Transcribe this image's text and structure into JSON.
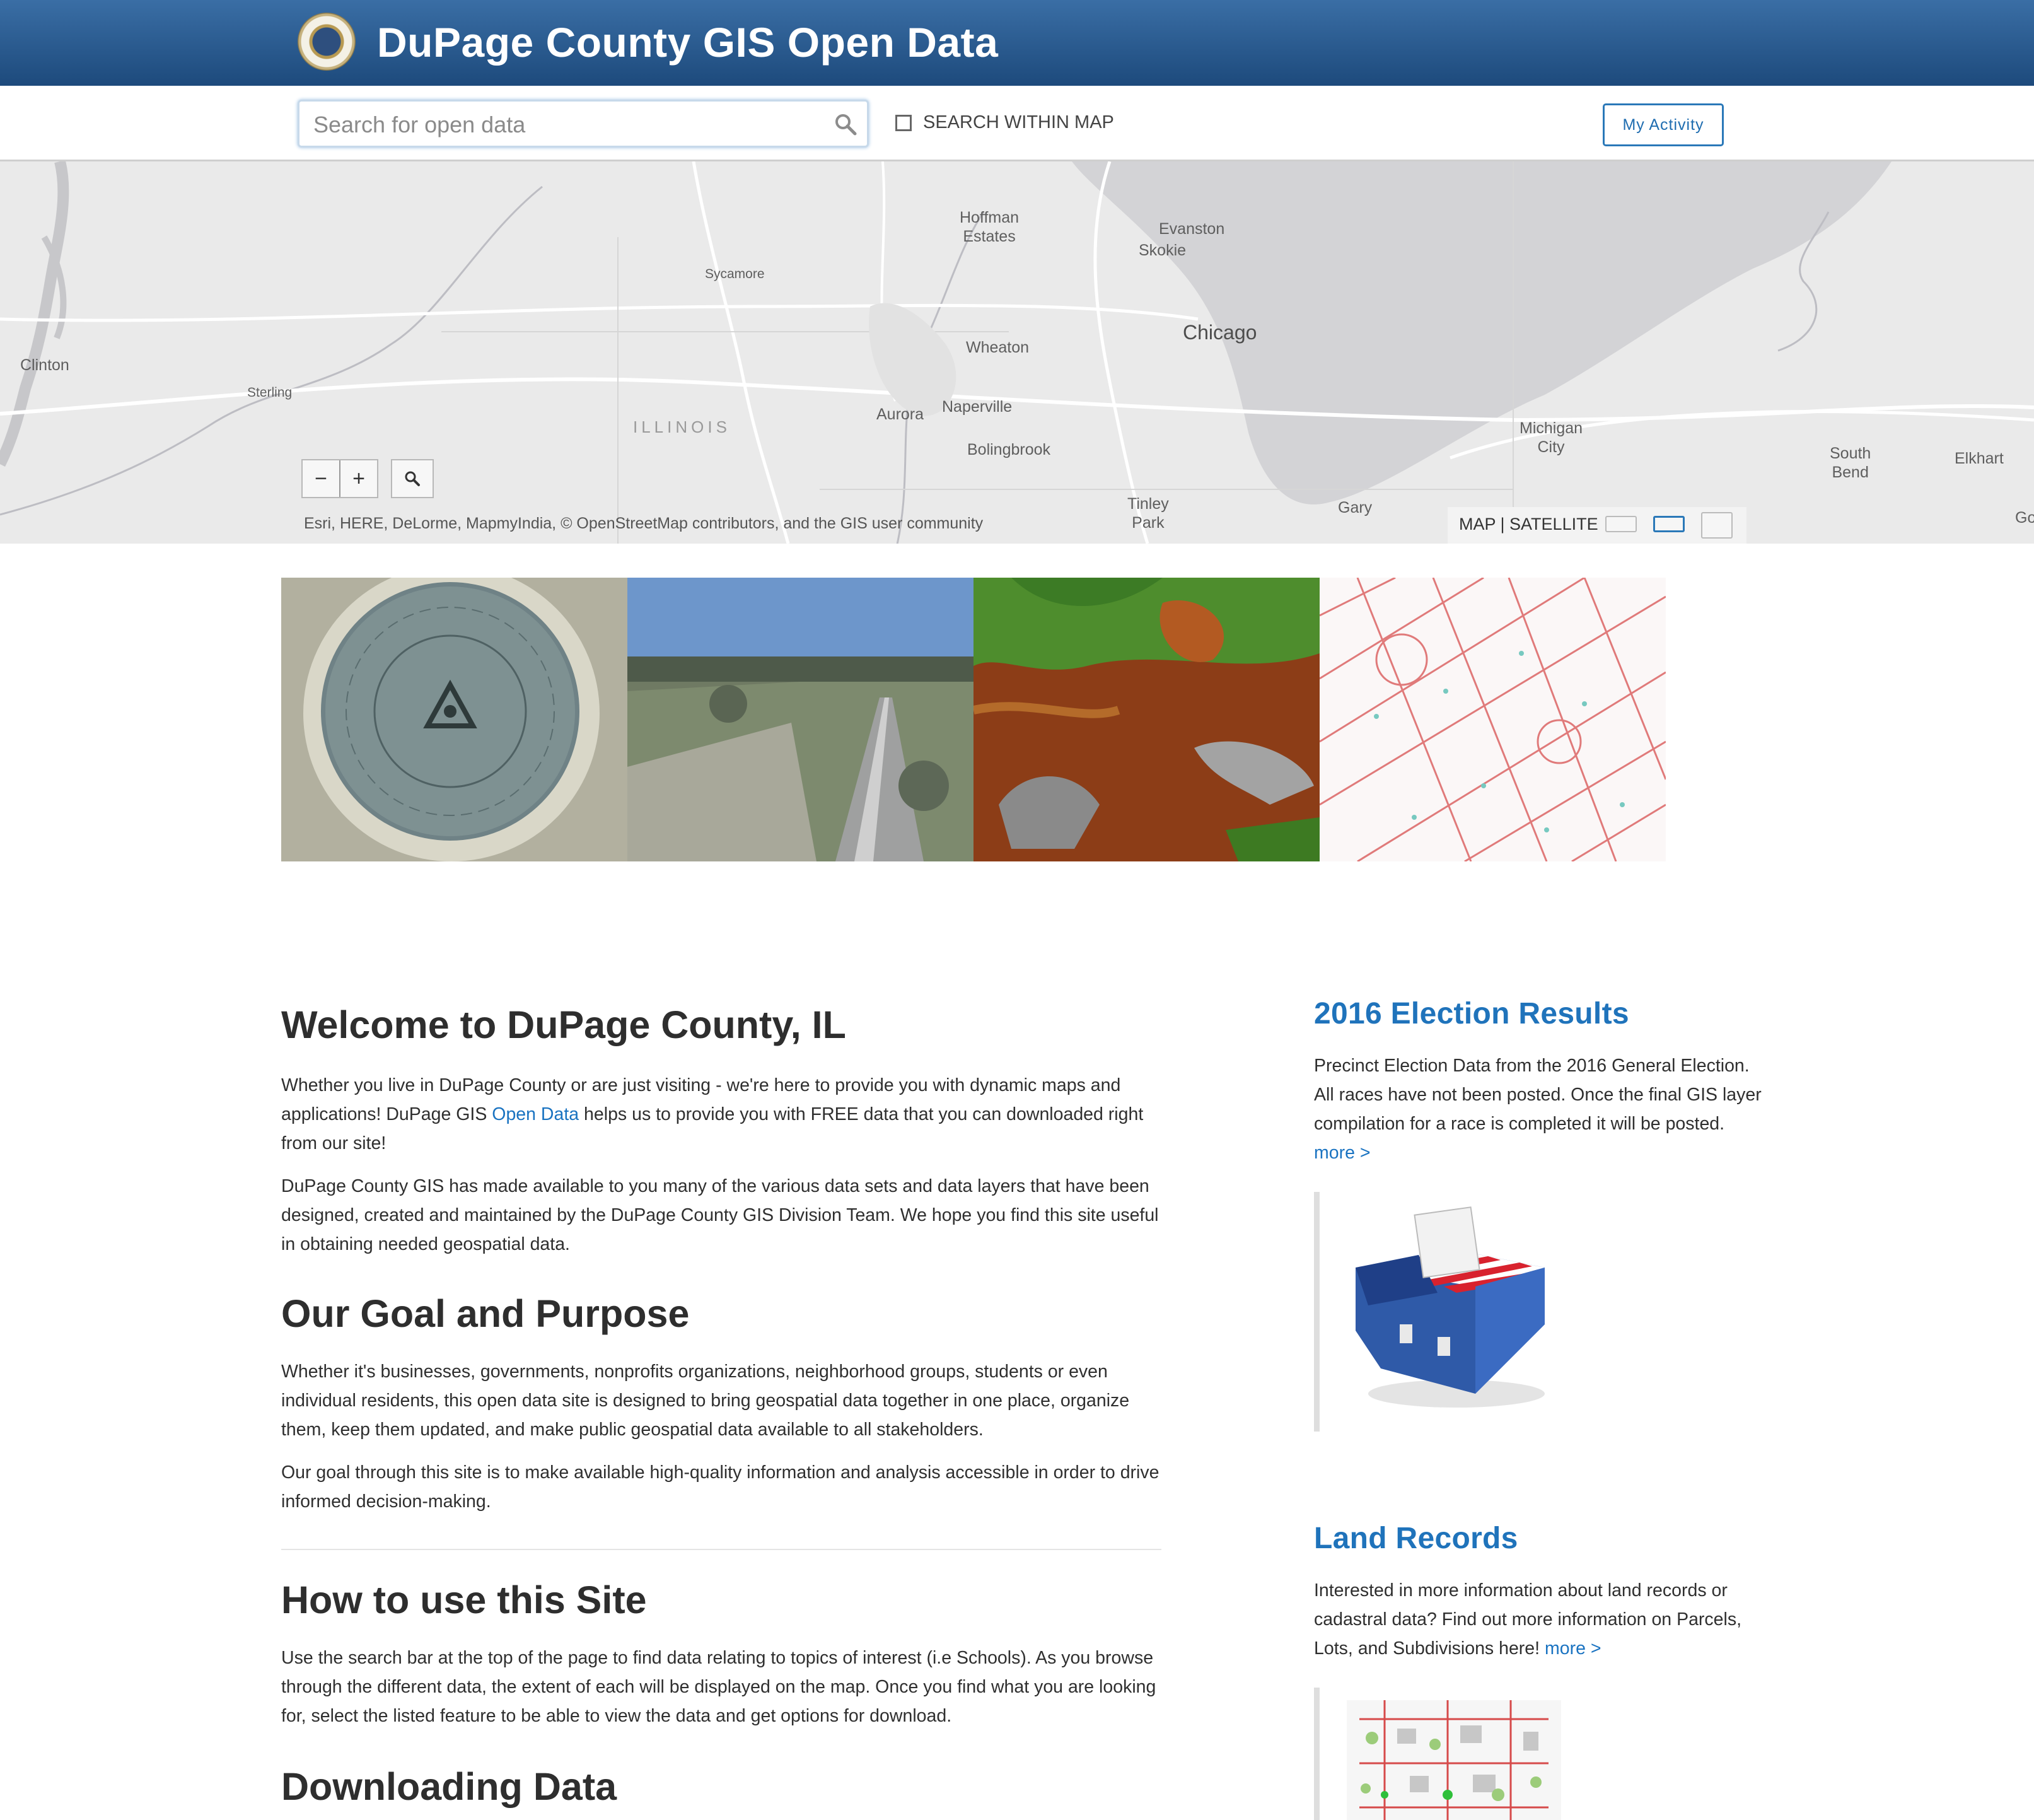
{
  "header": {
    "title": "DuPage County GIS Open Data"
  },
  "search": {
    "placeholder": "Search for open data",
    "within_map_label": "SEARCH WITHIN MAP",
    "within_map_checked": false,
    "activity_button": "My Activity"
  },
  "map": {
    "labels": {
      "clinton": "Clinton",
      "sterling": "Sterling",
      "sycamore": "Sycamore",
      "hoffman1": "Hoffman",
      "hoffman2": "Estates",
      "evanston": "Evanston",
      "skokie": "Skokie",
      "chicago": "Chicago",
      "wheaton": "Wheaton",
      "illinois": "ILLINOIS",
      "aurora": "Aurora",
      "naperville": "Naperville",
      "bolingbrook": "Bolingbrook",
      "michigan1": "Michigan",
      "michigan2": "City",
      "southbend1": "South",
      "southbend2": "Bend",
      "elkhart": "Elkhart",
      "tinley1": "Tinley",
      "tinley2": "Park",
      "gary": "Gary",
      "go": "Go"
    },
    "zoom_out": "−",
    "zoom_in": "+",
    "attribution": "Esri, HERE, DeLorme, MapmyIndia, © OpenStreetMap contributors, and the GIS user community",
    "basemap_label": "MAP | SATELLITE"
  },
  "strip": {
    "images": [
      "survey-benchmark-image",
      "aerial-3d-view-image",
      "elevation-raster-image",
      "parcel-map-image"
    ]
  },
  "content": {
    "welcome_title": "Welcome to DuPage County, IL",
    "welcome_p1_a": "Whether you live in DuPage County or are just visiting - we're here to provide you with dynamic maps and applications! DuPage GIS ",
    "welcome_p1_link": "Open Data",
    "welcome_p1_b": " helps us to provide you with FREE data that you can downloaded right from our site!",
    "welcome_p2": "DuPage County GIS has made available to you many of the various data sets and data layers that have been designed, created and maintained by the DuPage County GIS Division Team. We hope you find this site useful in obtaining needed geospatial data.",
    "goal_title": "Our Goal and Purpose",
    "goal_p1": "Whether it's businesses, governments, nonprofits organizations, neighborhood groups, students or even individual residents, this open data site is designed to bring geospatial data together in one place, organize them, keep them updated, and make public geospatial data available to all stakeholders.",
    "goal_p2": "Our goal through this site is to make available high-quality information and analysis accessible in order to drive informed decision-making.",
    "howto_title": "How to use this Site",
    "howto_p1": "Use the search bar at the top of the page to find data relating to topics of interest (i.e Schools). As you browse through the different data, the extent of each will be displayed on the map. Once you find what you are looking for, select the listed feature to be able to view the data and get options for download.",
    "download_title": "Downloading Data"
  },
  "sidebar": {
    "election_title": "2016 Election Results",
    "election_text": "Precinct Election Data from the 2016 General Election. All races have not been posted. Once the final GIS layer compilation for a race is completed it will be posted.",
    "election_more": "more >",
    "land_title": "Land Records",
    "land_text": "Interested in more information about land records or cadastral data? Find out more information on Parcels, Lots, and Subdivisions here!",
    "land_more": "more >"
  }
}
